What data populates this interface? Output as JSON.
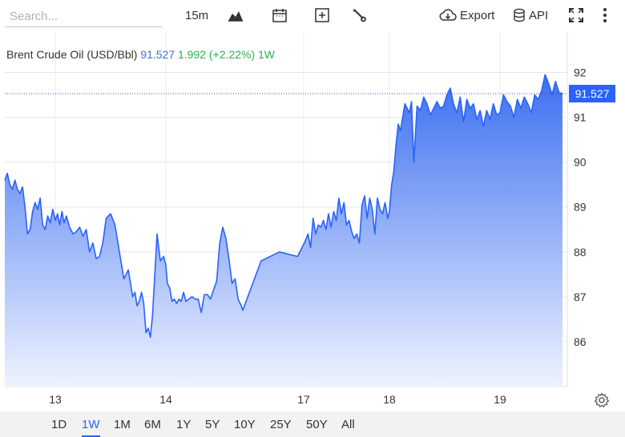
{
  "toolbar": {
    "search_placeholder": "Search...",
    "interval": "15m",
    "export_label": "Export",
    "api_label": "API"
  },
  "info": {
    "name": "Brent Crude Oil (USD/Bbl)",
    "price": "91.527",
    "change": "1.992 (+2.22%)",
    "period": "1W"
  },
  "last_price_label": "91.527",
  "ranges": [
    "1D",
    "1W",
    "1M",
    "6M",
    "1Y",
    "5Y",
    "10Y",
    "25Y",
    "50Y",
    "All"
  ],
  "active_range": "1W",
  "colors": {
    "line": "#2962ff",
    "fill_top": "#3d6ff0",
    "fill_bottom": "#eef3ff",
    "price_badge": "#2962ff",
    "price_text": "#3d6fd6",
    "change_text": "#2bb24c"
  },
  "chart_data": {
    "type": "area",
    "title": "Brent Crude Oil (USD/Bbl)",
    "xlabel": "",
    "ylabel": "",
    "y_ticks": [
      86,
      87,
      88,
      89,
      90,
      91,
      92
    ],
    "x_ticks": [
      "13",
      "14",
      "17",
      "18",
      "19"
    ],
    "ylim": [
      85.0,
      92.9
    ],
    "last_value": 91.527,
    "grid": true,
    "series": [
      {
        "name": "Brent Crude Oil (USD/Bbl)",
        "x": [
          12.6,
          12.62,
          12.64,
          12.66,
          12.68,
          12.7,
          12.72,
          12.74,
          12.76,
          12.78,
          12.8,
          12.82,
          12.84,
          12.86,
          12.88,
          12.9,
          12.92,
          12.94,
          12.96,
          12.98,
          13.0,
          13.02,
          13.04,
          13.06,
          13.08,
          13.1,
          13.13,
          13.16,
          13.19,
          13.22,
          13.25,
          13.28,
          13.31,
          13.34,
          13.37,
          13.4,
          13.43,
          13.46,
          13.5,
          13.54,
          13.58,
          13.62,
          13.66,
          13.7,
          13.72,
          13.74,
          13.76,
          13.78,
          13.8,
          13.82,
          13.84,
          13.86,
          13.88,
          13.9,
          13.92,
          13.95,
          13.98,
          14.0,
          14.02,
          14.05,
          14.08,
          14.11,
          14.14,
          14.17,
          14.2,
          14.23,
          14.26,
          14.3,
          14.34,
          14.38,
          14.42,
          14.46,
          14.5,
          14.54,
          14.58,
          14.62,
          14.66,
          14.7,
          14.74,
          14.78,
          14.82,
          14.86,
          14.9,
          14.94,
          14.98,
          15.0,
          16.9,
          16.93,
          16.96,
          16.99,
          17.02,
          17.05,
          17.08,
          17.11,
          17.14,
          17.17,
          17.2,
          17.23,
          17.26,
          17.29,
          17.32,
          17.35,
          17.38,
          17.41,
          17.44,
          17.47,
          17.5,
          17.53,
          17.56,
          17.59,
          17.62,
          17.65,
          17.68,
          17.71,
          17.74,
          17.77,
          17.8,
          17.83,
          17.86,
          17.89,
          17.92,
          17.95,
          17.98,
          18.0,
          18.02,
          18.04,
          18.06,
          18.08,
          18.1,
          18.12,
          18.14,
          18.16,
          18.18,
          18.2,
          18.22,
          18.25,
          18.28,
          18.31,
          18.34,
          18.37,
          18.4,
          18.43,
          18.46,
          18.49,
          18.52,
          18.55,
          18.58,
          18.61,
          18.64,
          18.67,
          18.7,
          18.73,
          18.76,
          18.79,
          18.82,
          18.85,
          18.88,
          18.91,
          18.94,
          18.97,
          19.0,
          19.03,
          19.06,
          19.09,
          19.12,
          19.15,
          19.18,
          19.21,
          19.24,
          19.27,
          19.3,
          19.33,
          19.36,
          19.39,
          19.42,
          19.45,
          19.48,
          19.51,
          19.54
        ],
        "values": [
          89.6,
          89.75,
          89.5,
          89.4,
          89.6,
          89.4,
          89.3,
          89.45,
          89.0,
          88.4,
          88.5,
          88.9,
          89.1,
          88.95,
          89.2,
          88.6,
          88.5,
          88.8,
          88.65,
          88.95,
          88.7,
          88.85,
          88.6,
          88.9,
          88.65,
          88.8,
          88.55,
          88.4,
          88.45,
          88.55,
          88.35,
          88.5,
          88.0,
          88.2,
          87.85,
          87.9,
          88.2,
          88.75,
          88.85,
          88.6,
          88.0,
          87.4,
          87.6,
          87.0,
          87.1,
          86.8,
          86.9,
          87.1,
          86.85,
          86.2,
          86.3,
          86.1,
          86.6,
          87.5,
          88.4,
          87.8,
          87.9,
          87.7,
          87.3,
          87.2,
          86.9,
          86.95,
          86.85,
          86.95,
          86.9,
          87.1,
          86.9,
          86.95,
          87.0,
          86.95,
          86.95,
          86.65,
          87.05,
          87.05,
          86.95,
          87.15,
          87.35,
          88.2,
          88.55,
          88.3,
          87.85,
          87.3,
          87.4,
          86.95,
          86.8,
          86.7,
          86.7,
          87.8,
          88.0,
          87.9,
          88.25,
          88.4,
          88.1,
          88.75,
          88.4,
          88.6,
          88.55,
          88.7,
          88.5,
          88.85,
          88.55,
          88.9,
          88.7,
          89.2,
          88.85,
          89.1,
          88.6,
          88.7,
          88.45,
          88.3,
          88.4,
          88.2,
          89.05,
          89.25,
          88.75,
          89.2,
          88.95,
          88.4,
          89.2,
          88.95,
          88.85,
          89.1,
          88.75,
          88.9,
          89.5,
          89.8,
          90.4,
          90.85,
          90.7,
          91.0,
          91.3,
          91.2,
          91.1,
          91.35,
          90.0,
          91.25,
          91.15,
          91.45,
          91.3,
          91.05,
          91.2,
          91.35,
          91.2,
          91.25,
          91.5,
          91.65,
          91.3,
          91.1,
          91.45,
          90.9,
          91.4,
          91.2,
          91.3,
          90.95,
          91.15,
          90.8,
          91.15,
          90.95,
          91.3,
          91.05,
          91.1,
          91.5,
          91.35,
          91.25,
          91.0,
          91.4,
          91.2,
          91.45,
          91.3,
          91.1,
          91.5,
          91.4,
          91.6,
          91.95,
          91.75,
          91.5,
          91.8,
          91.55,
          91.527
        ]
      }
    ]
  }
}
